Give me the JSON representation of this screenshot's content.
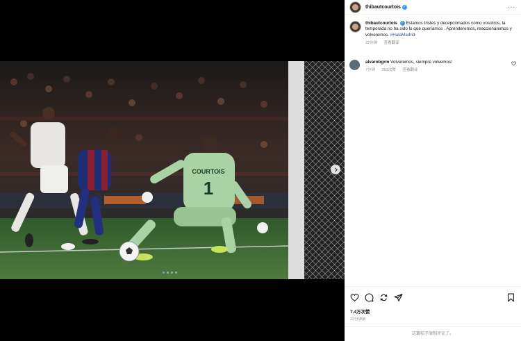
{
  "post": {
    "username": "thibautcourtois",
    "more_label": "···"
  },
  "caption": {
    "username": "thibautcourtois",
    "text": "Estamos tristes y decepcionados como vosotros, la temporada no ha sido lo que queríamos . Aprenderemos, reaccionaremos y volveremos.",
    "hashtag": "#HalaMadrid",
    "time": "22分钟",
    "translate": "查看翻译"
  },
  "comment": {
    "username": "alvarobgrm",
    "text": "Volveremos, siempre volvemos!",
    "time": "7分钟",
    "likes": "263次赞",
    "translate": "查看翻译"
  },
  "footer": {
    "likes": "7.4万次赞",
    "time": "22分钟前",
    "comments_closed": "这篇帖子限制评论了。"
  },
  "carousel": {
    "slide_count": 4,
    "active_index": 0
  },
  "photo": {
    "jersey_name": "COURTOIS",
    "jersey_number": "1"
  },
  "colors": {
    "link": "#385185",
    "verified": "#3897f0",
    "muted": "#8e8e8e",
    "pitch": "#4f7a3e",
    "keeper_kit": "#a9d3a4"
  },
  "icons": [
    "verified-icon",
    "more-icon",
    "heart-icon",
    "comment-icon",
    "share-icon",
    "send-icon",
    "bookmark-icon",
    "next-arrow-icon"
  ]
}
